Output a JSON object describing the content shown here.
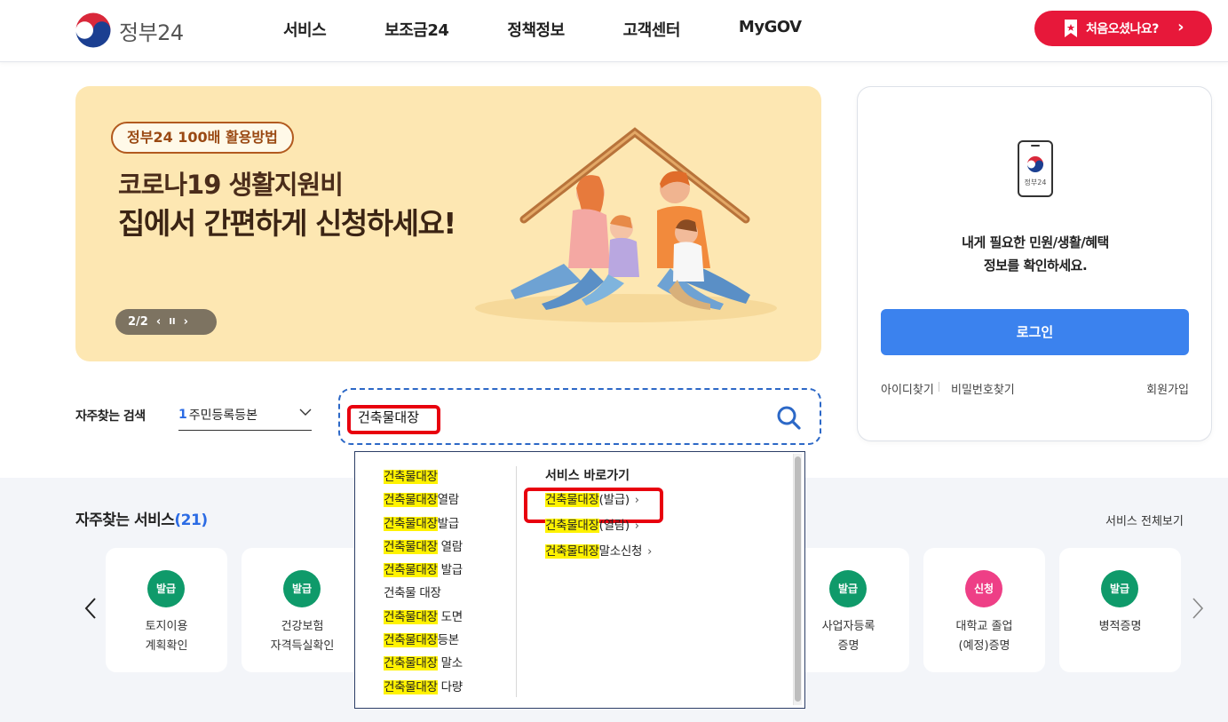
{
  "header": {
    "logo_text": "정부24",
    "nav": [
      "서비스",
      "보조금24",
      "정책정보",
      "고객센터",
      "MyGOV"
    ],
    "first_visit_label": "처음오셨나요?",
    "first_visit_arrow": "›"
  },
  "banner": {
    "badge": "정부24 100배 활용방법",
    "line1": "코로나19 생활지원비",
    "line2": "집에서 간편하게 신청하세요!",
    "pager": "2/2",
    "prev_icon": "‹",
    "pause_icon": "II",
    "next_icon": "›"
  },
  "login": {
    "phone_label": "정부24",
    "message_line1": "내게 필요한 민원/생활/혜택",
    "message_line2": "정보를 확인하세요.",
    "button": "로그인",
    "find_id": "아이디찾기",
    "find_pw": "비밀번호찾기",
    "signup": "회원가입"
  },
  "search": {
    "freq_label": "자주찾는 검색",
    "freq_num": "1",
    "freq_value": "주민등록등본",
    "query": "건축물대장"
  },
  "services": {
    "title": "자주찾는 서비스",
    "count": "(21)",
    "view_all": "서비스 전체보기",
    "colors": {
      "issue": "#0f9a6a",
      "apply": "#ee3f86"
    },
    "cards": [
      {
        "badge": "발급",
        "name": "토지이용\n계획확인",
        "color": "#0f9a6a"
      },
      {
        "badge": "발급",
        "name": "건강보험\n자격득실확인",
        "color": "#0f9a6a"
      },
      {
        "badge": "발급",
        "name": "사업자등록\n증명",
        "color": "#0f9a6a"
      },
      {
        "badge": "신청",
        "name": "대학교 졸업\n(예정)증명",
        "color": "#ee3f86"
      },
      {
        "badge": "발급",
        "name": "병적증명",
        "color": "#0f9a6a"
      }
    ]
  },
  "autocomplete": {
    "suggestions": [
      {
        "mark": "건축물대장",
        "rest": ""
      },
      {
        "mark": "건축물대장",
        "rest": "열람"
      },
      {
        "mark": "건축물대장",
        "rest": "발급"
      },
      {
        "mark": "건축물대장",
        "rest": " 열람"
      },
      {
        "mark": "건축물대장",
        "rest": " 발급"
      },
      {
        "mark": "",
        "rest": "건축물 대장"
      },
      {
        "mark": "건축물대장",
        "rest": " 도면"
      },
      {
        "mark": "건축물대장",
        "rest": "등본"
      },
      {
        "mark": "건축물대장",
        "rest": " 말소"
      },
      {
        "mark": "건축물대장",
        "rest": " 다량"
      }
    ],
    "shortcut_title": "서비스 바로가기",
    "shortcuts": [
      {
        "mark": "건축물대장",
        "rest": "(발급)"
      },
      {
        "mark": "건축물대장",
        "rest": "(열람)"
      },
      {
        "mark": "건축물대장",
        "rest": "말소신청"
      }
    ],
    "shortcut_arrow": "›"
  },
  "highlight_color": "#fff200"
}
